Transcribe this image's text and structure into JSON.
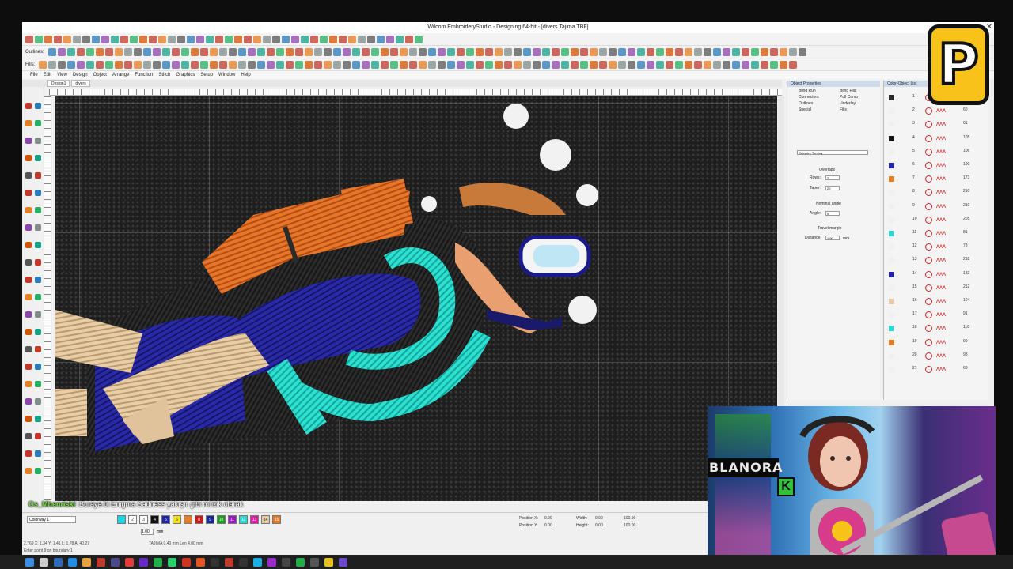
{
  "window": {
    "title": "Wilcom EmbroideryStudio - Designing 64-bit - [divers     Tajima TBF]"
  },
  "toolbar": {
    "outlines_label": "Outlines:",
    "fills_label": "Fills:",
    "zoom_value": "931",
    "units_value": "Metric"
  },
  "menu": [
    "File",
    "Edit",
    "View",
    "Design",
    "Object",
    "Arrange",
    "Function",
    "Stitch",
    "Graphics",
    "Setup",
    "Window",
    "Help"
  ],
  "doc_tabs": [
    "Design1",
    "divers"
  ],
  "object_properties": {
    "title": "Object Properties",
    "tabs_left": [
      "Bling Run",
      "Connectors",
      "Outlines",
      "Special"
    ],
    "tabs_right": [
      "Bling Fills",
      "Pull Comp",
      "Underlay",
      "Fills"
    ],
    "stitch_type": "Complex Turning",
    "overlaps_label": "Overlaps",
    "rows_label": "Rows:",
    "rows_value": "2",
    "taper_label": "Taper:",
    "taper_value": "20",
    "nominal_label": "Nominal angle",
    "angle_label": "Angle:",
    "angle_value": "0",
    "travel_label": "Travel margin",
    "distance_label": "Distance:",
    "distance_value": "1.50",
    "distance_unit": "mm"
  },
  "color_object_list": {
    "title": "Color-Object List",
    "rows": [
      {
        "n": "1",
        "color": "#2a2a2a",
        "val": ""
      },
      {
        "n": "2",
        "color": "#f0f0f0",
        "val": "60"
      },
      {
        "n": "3",
        "color": "#f0f0f0",
        "val": "61"
      },
      {
        "n": "4",
        "color": "#111111",
        "val": "105"
      },
      {
        "n": "5",
        "color": "#f0f0f0",
        "val": "106"
      },
      {
        "n": "6",
        "color": "#2424a8",
        "val": "190"
      },
      {
        "n": "7",
        "color": "#e87a22",
        "val": "173"
      },
      {
        "n": "8",
        "color": "#f0f0f0",
        "val": "210"
      },
      {
        "n": "9",
        "color": "#f0f0f0",
        "val": "210"
      },
      {
        "n": "10",
        "color": "#f0f0f0",
        "val": "205"
      },
      {
        "n": "11",
        "color": "#2ad9d0",
        "val": "81"
      },
      {
        "n": "12",
        "color": "#f0f0f0",
        "val": "73"
      },
      {
        "n": "13",
        "color": "#f0f0f0",
        "val": "218"
      },
      {
        "n": "14",
        "color": "#2424a8",
        "val": "133"
      },
      {
        "n": "15",
        "color": "#f0f0f0",
        "val": "212"
      },
      {
        "n": "16",
        "color": "#e8c8a0",
        "val": "104"
      },
      {
        "n": "17",
        "color": "#f0f0f0",
        "val": "91"
      },
      {
        "n": "18",
        "color": "#2ad9d0",
        "val": "118"
      },
      {
        "n": "19",
        "color": "#e87a22",
        "val": "99"
      },
      {
        "n": "20",
        "color": "#f0f0f0",
        "val": "93"
      },
      {
        "n": "21",
        "color": "#f0f0f0",
        "val": "68"
      }
    ]
  },
  "chat": {
    "user": "Os_Mhenriski",
    "message": ": Buraya bi Enigma Sadness yakışır gibi müzik olarak"
  },
  "bottom": {
    "colorway": "Colorway 1",
    "palette": [
      {
        "color": "#18d8e6",
        "label": ""
      },
      {
        "color": "#ffffff",
        "label": "2"
      },
      {
        "color": "#ffffff",
        "label": "3"
      },
      {
        "color": "#111111",
        "label": "4"
      },
      {
        "color": "#2424a8",
        "label": "5"
      },
      {
        "color": "#f2e21c",
        "label": "6"
      },
      {
        "color": "#e87a22",
        "label": "7"
      },
      {
        "color": "#cc1a1a",
        "label": "8"
      },
      {
        "color": "#1a2a9a",
        "label": "9"
      },
      {
        "color": "#1aa01a",
        "label": "10"
      },
      {
        "color": "#9a1ac8",
        "label": "11"
      },
      {
        "color": "#2ad9d0",
        "label": "12"
      },
      {
        "color": "#e81aa8",
        "label": "13"
      },
      {
        "color": "#e8c8a0",
        "label": "14"
      },
      {
        "color": "#e87a22",
        "label": "15"
      }
    ],
    "position_x_label": "Position X:",
    "position_y_label": "Position Y:",
    "width_label": "Width:",
    "height_label": "Height:",
    "pos_x": "0.00",
    "pos_y": "0.00",
    "width": "0.00",
    "height": "0.00",
    "pct_w": "100.00",
    "pct_h": "100.00",
    "zoom_field": "1.00",
    "zoom_unit": "mm"
  },
  "status": {
    "coords": "2,769     X: 1.34 Y: 1.41 L: 1.78 A: 40.27",
    "machine": "TAJIMA  0.40 mm Len 4.00 mm",
    "hint": "Enter point 9 on boundary 1"
  },
  "webcam": {
    "sign_text": "BLANORA",
    "k_block": "K"
  },
  "overlay": {
    "logo_letter": "P"
  }
}
